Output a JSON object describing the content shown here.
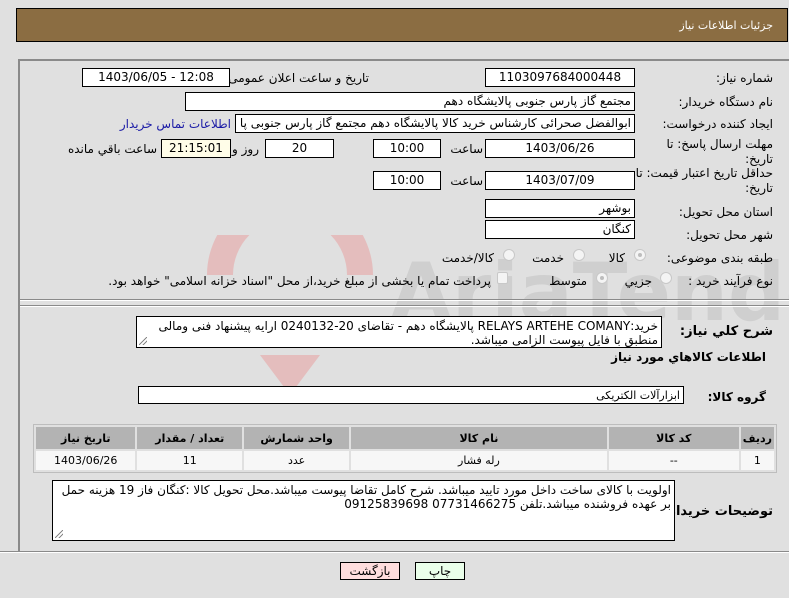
{
  "header": {
    "title": "جزئیات اطلاعات نیاز"
  },
  "form": {
    "need_number": {
      "label": "شماره نیاز:",
      "value": "1103097684000448"
    },
    "announce_datetime": {
      "label": "تاریخ و ساعت اعلان عمومی:",
      "value": "1403/06/05 - 12:08"
    },
    "buyer_org": {
      "label": "نام دستگاه خریدار:",
      "value": "مجتمع گاز پارس جنوبی  پالایشگاه دهم"
    },
    "requester": {
      "label": "ایجاد کننده درخواست:",
      "value": "ابوالفضل صحرائی کارشناس خرید کالا پالایشگاه دهم مجتمع گاز پارس جنوبی  پا",
      "contact_link": "اطلاعات تماس خریدار"
    },
    "reply_deadline": {
      "label_line1": "مهلت ارسال پاسخ: تا",
      "label_line2": "تاریخ:",
      "date": "1403/06/26",
      "time_label": "ساعت",
      "time": "10:00",
      "days": "20",
      "days_label": "روز و",
      "remaining": "21:15:01",
      "remaining_label": "ساعت باقي مانده"
    },
    "price_validity": {
      "label_line1": "حداقل تاریخ اعتبار قیمت: تا",
      "label_line2": "تاریخ:",
      "date": "1403/07/09",
      "time_label": "ساعت",
      "time": "10:00"
    },
    "province": {
      "label": "استان محل تحویل:",
      "value": "بوشهر"
    },
    "city": {
      "label": "شهر محل تحویل:",
      "value": "کنگان"
    },
    "category": {
      "label": "طبقه بندی موضوعی:",
      "options": [
        "کالا",
        "خدمت",
        "کالا/خدمت"
      ],
      "selected": "کالا"
    },
    "purchase_type": {
      "label": "نوع فرآیند خرید :",
      "options": [
        "جزیي",
        "متوسط"
      ],
      "selected": "متوسط",
      "treasury_checkbox_label": "پرداخت تمام یا بخشی از مبلغ خرید،از محل \"اسناد خزانه اسلامی\" خواهد بود.",
      "treasury_checked": false
    }
  },
  "description": {
    "label": "شرح کلي نياز:",
    "value": "خرید:RELAYS ARTEHE COMANY پالایشگاه دهم - تقاضای 20-0240132 ارایه پیشنهاد فنی ومالی منطبق با فایل پیوست الزامی میباشد."
  },
  "goods_section": {
    "title": "اطلاعات کالاهاي مورد نياز",
    "group_label": "گروه کالا:",
    "group_value": "ابزارآلات الکتریکی",
    "table": {
      "headers": [
        "ردیف",
        "کد کالا",
        "نام کالا",
        "واحد شمارش",
        "تعداد / مقدار",
        "تاریخ نیاز"
      ],
      "rows": [
        [
          "1",
          "--",
          "رله فشار",
          "عدد",
          "11",
          "1403/06/26"
        ]
      ]
    }
  },
  "buyer_notes": {
    "label": "توضیحات خریدار:",
    "value": "اولویت با کالای ساخت داخل مورد تایید میباشد. شرح کامل تقاضا پیوست میباشد.محل تحویل کالا :کنگان فاز 19 هزینه حمل بر عهده فروشنده میباشد.تلفن 07731466275  09125839698"
  },
  "buttons": {
    "print": "چاپ",
    "back": "بازگشت"
  },
  "colors": {
    "header_bg": "#8b6d42",
    "print_bg": "#eaffea",
    "back_bg": "#ffdede",
    "link": "#1a1aa6"
  }
}
